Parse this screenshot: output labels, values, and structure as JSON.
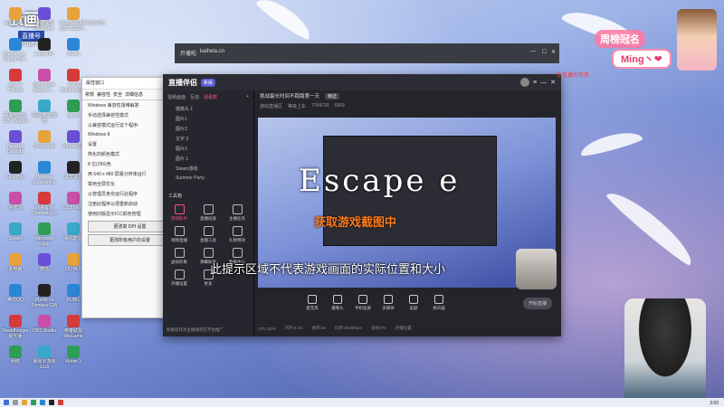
{
  "overlay": {
    "logo": "1t画",
    "channel_badge": "直播号",
    "room_number": "7704730",
    "ranking_label": "周榜冠名",
    "ranking_user": "Ming丶❤",
    "red_note": "你直播的东西"
  },
  "desktop_icons": [
    {
      "label": "Administr..."
    },
    {
      "label": "Counter-S... Global Off..."
    },
    {
      "label": "Sea of Thieves"
    },
    {
      "label": "网易云音乐 2.2.4 Squad"
    },
    {
      "label": "Dead by Daylight"
    },
    {
      "label": "Launcher"
    },
    {
      "label": "回收站"
    },
    {
      "label": "Steam"
    },
    {
      "label": "此电脑"
    },
    {
      "label": "腾讯QQ"
    },
    {
      "label": "Dreadhunger 船长版"
    },
    {
      "label": "网络"
    },
    {
      "label": "英雄联盟 WeGame"
    },
    {
      "label": "Launcher"
    },
    {
      "label": "Battlestate Games L..."
    },
    {
      "label": "网易UU加速器"
    },
    {
      "label": "Overwatch"
    },
    {
      "label": "Defense Experience"
    },
    {
      "label": "网易有道 Overwatch 2"
    },
    {
      "label": "Microsoft Edge"
    },
    {
      "label": "微信"
    },
    {
      "label": "Plants vs Zombies GW"
    },
    {
      "label": "OBS Studio"
    },
    {
      "label": "网易云游戏 GG5"
    },
    {
      "label": "PLAYERUNKNOWN'S BATTLEGR..."
    },
    {
      "label": "Steam"
    },
    {
      "label": "Clock Battlemaster"
    },
    {
      "label": "Spore"
    },
    {
      "label": "Among Us"
    },
    {
      "label": "录屏设置"
    },
    {
      "label": "1.3.1 Nano"
    },
    {
      "label": "暴风影音"
    },
    {
      "label": "DOTA 2"
    },
    {
      "label": "PUBG"
    },
    {
      "label": "英雄联盟 WeGame"
    },
    {
      "label": "Mobin 3"
    }
  ],
  "props_window": {
    "title": "属性窗口",
    "tabs": [
      "常规",
      "兼容性",
      "安全",
      "详细信息"
    ],
    "rows": [
      "Windows 兼容性疑难解答",
      "手动选择兼容性模式",
      "以兼容模式运行这个程序:",
      "Windows 8",
      "设置",
      "简化的颜色模式",
      "8 位(256)色",
      "用 640 x 480 屏幕分辨率运行",
      "禁用全屏优化",
      "以管理员身份运行此程序",
      "注册此程序以便重新启动",
      "使用旧版显示ICC颜色管理"
    ],
    "btn_change": "更改高 DPI 设置",
    "btn_all": "更改所有用户的设置"
  },
  "browser": {
    "tab": "开播啦",
    "url": "kaihela.cn"
  },
  "app": {
    "title": "直播伴侣",
    "badge": "新版",
    "left_tabs": [
      "视频画面",
      "互动",
      "观看数"
    ],
    "scenes": [
      "摄像头 1",
      "图片1",
      "图片2",
      "文字 2",
      "图片3",
      "图片 1",
      "Steam游戏",
      "Summer Party"
    ],
    "tools_title": "工具箱",
    "tools": [
      {
        "label": "游戏助手",
        "hot": true
      },
      {
        "label": "直播投屏"
      },
      {
        "label": "主播任务"
      },
      {
        "label": "视频直播"
      },
      {
        "label": "直播工具"
      },
      {
        "label": "礼物特效"
      },
      {
        "label": "虚拟形象"
      },
      {
        "label": "弹幕助手"
      },
      {
        "label": "数据中心"
      },
      {
        "label": "开播设置"
      },
      {
        "label": "更多"
      }
    ],
    "bottom_note": "如果您作为主播请勿在平台推广",
    "room_title": "挑战最长时间不跑路第一天",
    "room_tag": "精选",
    "room_sub": [
      "游戏直播区",
      "等级上车",
      "7704730",
      "6969"
    ],
    "preview_title_big": "Escape e",
    "preview_subtitle": "获取游戏截图中",
    "preview_hint": "此提示区域不代表游戏画面的实际位置和大小",
    "controls": [
      "麦克风",
      "摄像头",
      "手机投屏",
      "多媒体",
      "美颜",
      "扬声器"
    ],
    "start_button": "开始直播",
    "status": [
      "CPU:30%",
      "内存:8.2G",
      "帧率:60",
      "码率:4500kbps",
      "丢帧:0%",
      "开播设置"
    ]
  },
  "taskbar": {
    "clock": "3:50"
  }
}
